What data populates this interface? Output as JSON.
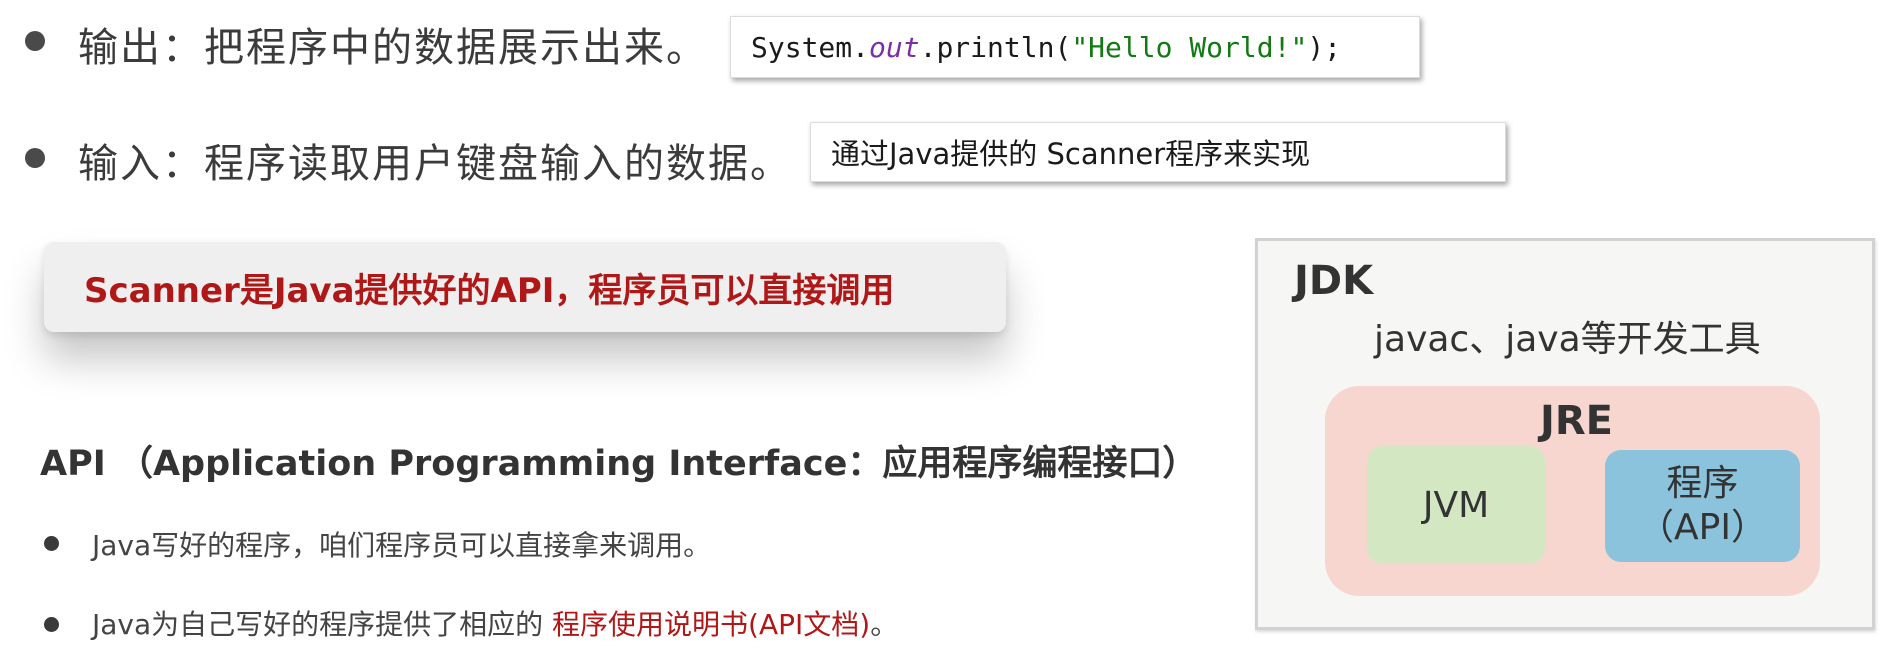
{
  "output_row": {
    "text": "输出：把程序中的数据展示出来。",
    "code": {
      "prefix": "System.",
      "out": "out",
      "middle": ".println(",
      "string": "\"Hello World!\"",
      "suffix": ");"
    }
  },
  "input_row": {
    "text": "输入：程序读取用户键盘输入的数据。",
    "note": "通过Java提供的 Scanner程序来实现"
  },
  "callout": {
    "text": "Scanner是Java提供好的API，程序员可以直接调用"
  },
  "api_section": {
    "heading": "API （Application Programming Interface：应用程序编程接口）",
    "bullets": [
      {
        "text": "Java写好的程序，咱们程序员可以直接拿来调用。"
      },
      {
        "text_plain": "Java为自己写好的程序提供了相应的 ",
        "text_highlight": "程序使用说明书(API文档)",
        "text_end": "。"
      }
    ]
  },
  "diagram": {
    "jdk_label": "JDK",
    "jdk_tools": "javac、java等开发工具",
    "jre_label": "JRE",
    "jvm_label": "JVM",
    "program_label": "程序",
    "api_label": "（API）",
    "colors": {
      "jdk_bg": "#f6f6f5",
      "jre_bg": "#f8d6d0",
      "jvm_bg": "#d3e8c2",
      "api_bg": "#8cc3dc",
      "highlight_red": "#b01818"
    }
  }
}
